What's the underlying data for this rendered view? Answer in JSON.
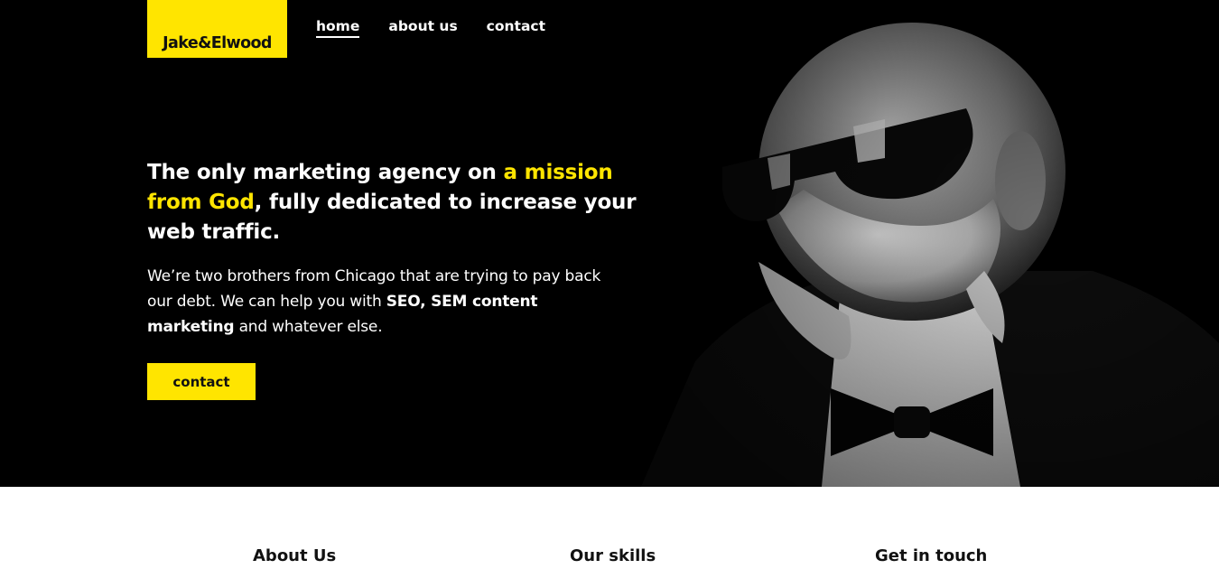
{
  "brand": {
    "logo_text": "Jake&Elwood",
    "accent_color": "#ffe500"
  },
  "nav": {
    "items": [
      {
        "label": "home",
        "active": true
      },
      {
        "label": "about us",
        "active": false
      },
      {
        "label": "contact",
        "active": false
      }
    ]
  },
  "hero": {
    "headline_part1": "The only marketing agency on ",
    "headline_highlight": "a mission from God",
    "headline_part2": ", fully dedicated to increase your web traffic.",
    "lead_part1": "We’re two brothers from Chicago that are trying to pay back our debt. We can help you with ",
    "lead_bold": "SEO, SEM content marketing",
    "lead_part2": " and whatever else.",
    "cta_label": "contact"
  },
  "sections": {
    "titles": [
      "About Us",
      "Our skills",
      "Get in touch"
    ]
  }
}
